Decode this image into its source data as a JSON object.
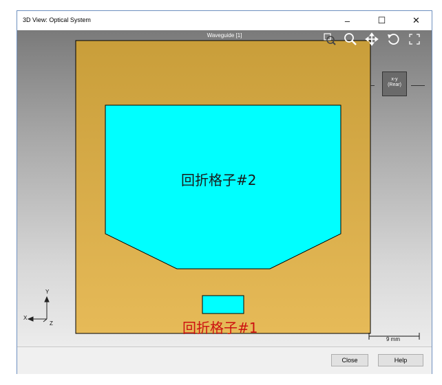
{
  "window": {
    "title": "3D View: Optical System",
    "minimize_glyph": "–",
    "maximize_glyph": "☐",
    "close_glyph": "✕"
  },
  "viewport": {
    "caption": "Waveguide [1]",
    "toolbar": [
      "zoom-window-icon",
      "zoom-icon",
      "pan-icon",
      "rotate-icon",
      "fit-icon"
    ],
    "orientation": {
      "line1": "x-y",
      "line2": "(Rear)"
    },
    "grating2_label": "回折格子#2",
    "grating1_label": "回折格子#1",
    "axes": {
      "y": "Y",
      "x": "X",
      "z": "Z"
    },
    "scale_label": "9 mm",
    "colors": {
      "waveguide_top": "#c99e3a",
      "waveguide_bottom": "#e6ba58",
      "grating_fill": "#00ffff",
      "grating2_text": "#1a1a1a",
      "grating1_text": "#cc1111"
    }
  },
  "footer": {
    "close_label": "Close",
    "help_label": "Help"
  }
}
